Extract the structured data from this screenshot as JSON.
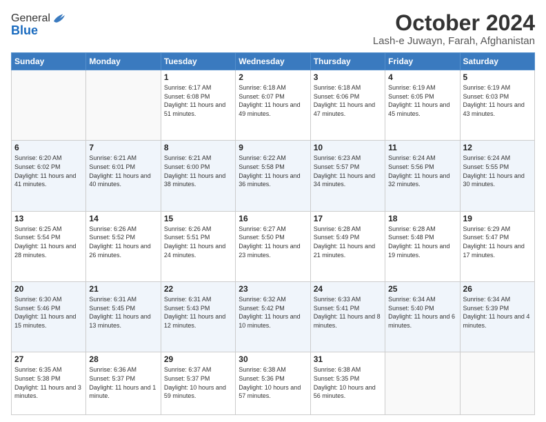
{
  "logo": {
    "general": "General",
    "blue": "Blue"
  },
  "header": {
    "month": "October 2024",
    "location": "Lash-e Juwayn, Farah, Afghanistan"
  },
  "weekdays": [
    "Sunday",
    "Monday",
    "Tuesday",
    "Wednesday",
    "Thursday",
    "Friday",
    "Saturday"
  ],
  "weeks": [
    [
      {
        "day": "",
        "info": ""
      },
      {
        "day": "",
        "info": ""
      },
      {
        "day": "1",
        "info": "Sunrise: 6:17 AM\nSunset: 6:08 PM\nDaylight: 11 hours and 51 minutes."
      },
      {
        "day": "2",
        "info": "Sunrise: 6:18 AM\nSunset: 6:07 PM\nDaylight: 11 hours and 49 minutes."
      },
      {
        "day": "3",
        "info": "Sunrise: 6:18 AM\nSunset: 6:06 PM\nDaylight: 11 hours and 47 minutes."
      },
      {
        "day": "4",
        "info": "Sunrise: 6:19 AM\nSunset: 6:05 PM\nDaylight: 11 hours and 45 minutes."
      },
      {
        "day": "5",
        "info": "Sunrise: 6:19 AM\nSunset: 6:03 PM\nDaylight: 11 hours and 43 minutes."
      }
    ],
    [
      {
        "day": "6",
        "info": "Sunrise: 6:20 AM\nSunset: 6:02 PM\nDaylight: 11 hours and 41 minutes."
      },
      {
        "day": "7",
        "info": "Sunrise: 6:21 AM\nSunset: 6:01 PM\nDaylight: 11 hours and 40 minutes."
      },
      {
        "day": "8",
        "info": "Sunrise: 6:21 AM\nSunset: 6:00 PM\nDaylight: 11 hours and 38 minutes."
      },
      {
        "day": "9",
        "info": "Sunrise: 6:22 AM\nSunset: 5:58 PM\nDaylight: 11 hours and 36 minutes."
      },
      {
        "day": "10",
        "info": "Sunrise: 6:23 AM\nSunset: 5:57 PM\nDaylight: 11 hours and 34 minutes."
      },
      {
        "day": "11",
        "info": "Sunrise: 6:24 AM\nSunset: 5:56 PM\nDaylight: 11 hours and 32 minutes."
      },
      {
        "day": "12",
        "info": "Sunrise: 6:24 AM\nSunset: 5:55 PM\nDaylight: 11 hours and 30 minutes."
      }
    ],
    [
      {
        "day": "13",
        "info": "Sunrise: 6:25 AM\nSunset: 5:54 PM\nDaylight: 11 hours and 28 minutes."
      },
      {
        "day": "14",
        "info": "Sunrise: 6:26 AM\nSunset: 5:52 PM\nDaylight: 11 hours and 26 minutes."
      },
      {
        "day": "15",
        "info": "Sunrise: 6:26 AM\nSunset: 5:51 PM\nDaylight: 11 hours and 24 minutes."
      },
      {
        "day": "16",
        "info": "Sunrise: 6:27 AM\nSunset: 5:50 PM\nDaylight: 11 hours and 23 minutes."
      },
      {
        "day": "17",
        "info": "Sunrise: 6:28 AM\nSunset: 5:49 PM\nDaylight: 11 hours and 21 minutes."
      },
      {
        "day": "18",
        "info": "Sunrise: 6:28 AM\nSunset: 5:48 PM\nDaylight: 11 hours and 19 minutes."
      },
      {
        "day": "19",
        "info": "Sunrise: 6:29 AM\nSunset: 5:47 PM\nDaylight: 11 hours and 17 minutes."
      }
    ],
    [
      {
        "day": "20",
        "info": "Sunrise: 6:30 AM\nSunset: 5:46 PM\nDaylight: 11 hours and 15 minutes."
      },
      {
        "day": "21",
        "info": "Sunrise: 6:31 AM\nSunset: 5:45 PM\nDaylight: 11 hours and 13 minutes."
      },
      {
        "day": "22",
        "info": "Sunrise: 6:31 AM\nSunset: 5:43 PM\nDaylight: 11 hours and 12 minutes."
      },
      {
        "day": "23",
        "info": "Sunrise: 6:32 AM\nSunset: 5:42 PM\nDaylight: 11 hours and 10 minutes."
      },
      {
        "day": "24",
        "info": "Sunrise: 6:33 AM\nSunset: 5:41 PM\nDaylight: 11 hours and 8 minutes."
      },
      {
        "day": "25",
        "info": "Sunrise: 6:34 AM\nSunset: 5:40 PM\nDaylight: 11 hours and 6 minutes."
      },
      {
        "day": "26",
        "info": "Sunrise: 6:34 AM\nSunset: 5:39 PM\nDaylight: 11 hours and 4 minutes."
      }
    ],
    [
      {
        "day": "27",
        "info": "Sunrise: 6:35 AM\nSunset: 5:38 PM\nDaylight: 11 hours and 3 minutes."
      },
      {
        "day": "28",
        "info": "Sunrise: 6:36 AM\nSunset: 5:37 PM\nDaylight: 11 hours and 1 minute."
      },
      {
        "day": "29",
        "info": "Sunrise: 6:37 AM\nSunset: 5:37 PM\nDaylight: 10 hours and 59 minutes."
      },
      {
        "day": "30",
        "info": "Sunrise: 6:38 AM\nSunset: 5:36 PM\nDaylight: 10 hours and 57 minutes."
      },
      {
        "day": "31",
        "info": "Sunrise: 6:38 AM\nSunset: 5:35 PM\nDaylight: 10 hours and 56 minutes."
      },
      {
        "day": "",
        "info": ""
      },
      {
        "day": "",
        "info": ""
      }
    ]
  ]
}
